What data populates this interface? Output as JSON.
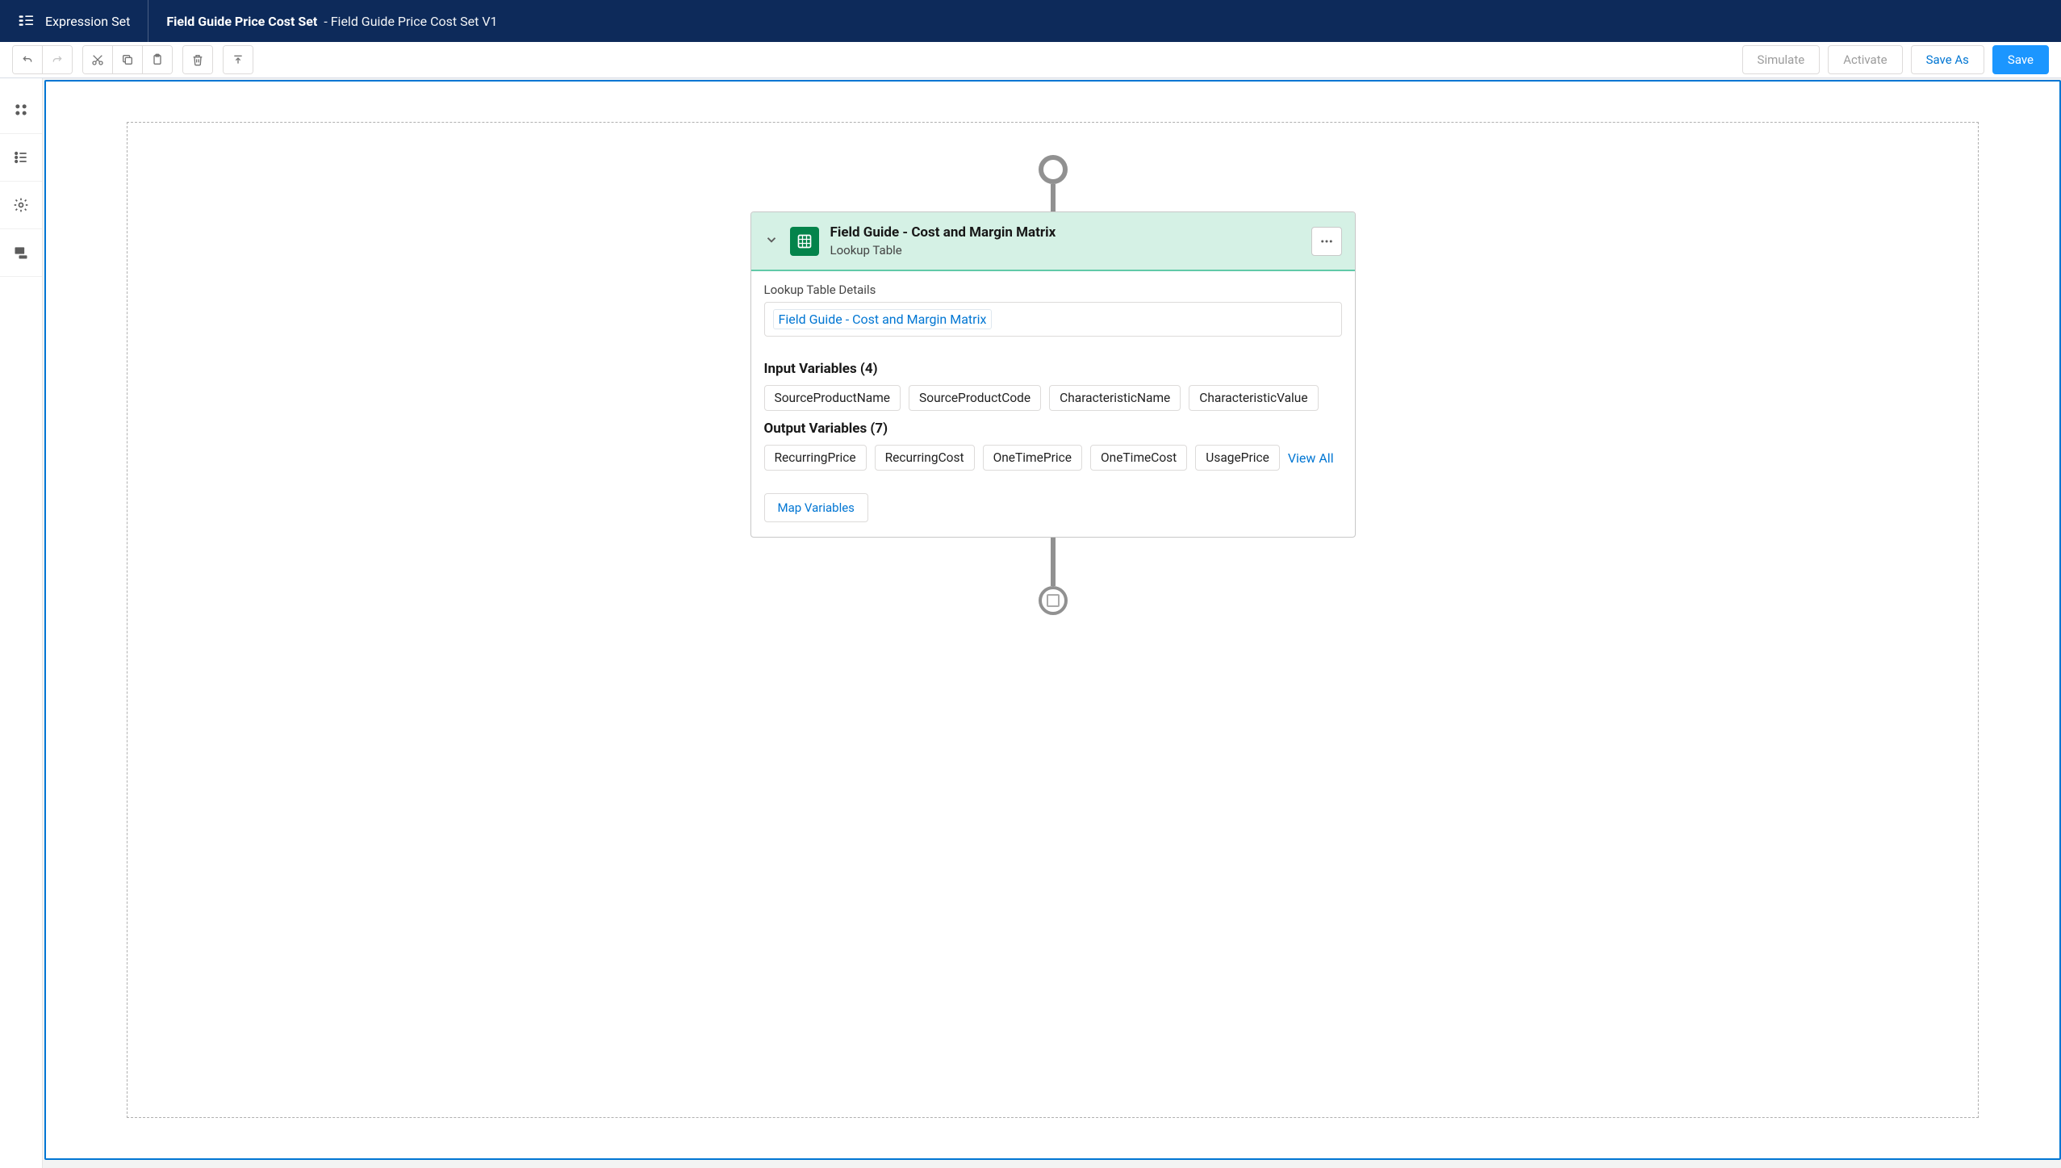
{
  "header": {
    "app_label": "Expression Set",
    "title_main": "Field Guide Price Cost Set",
    "title_sub": "Field Guide Price Cost Set V1"
  },
  "toolbar": {
    "simulate": "Simulate",
    "activate": "Activate",
    "save_as": "Save As",
    "save": "Save"
  },
  "node": {
    "title": "Field Guide - Cost and Margin Matrix",
    "subtitle": "Lookup Table",
    "details_label": "Lookup Table Details",
    "details_link": "Field Guide - Cost and Margin Matrix",
    "input_vars_title": "Input Variables (4)",
    "input_vars": [
      "SourceProductName",
      "SourceProductCode",
      "CharacteristicName",
      "CharacteristicValue"
    ],
    "output_vars_title": "Output Variables (7)",
    "output_vars_visible": [
      "RecurringPrice",
      "RecurringCost",
      "OneTimePrice",
      "OneTimeCost",
      "UsagePrice"
    ],
    "view_all": "View All",
    "map_vars": "Map Variables"
  }
}
